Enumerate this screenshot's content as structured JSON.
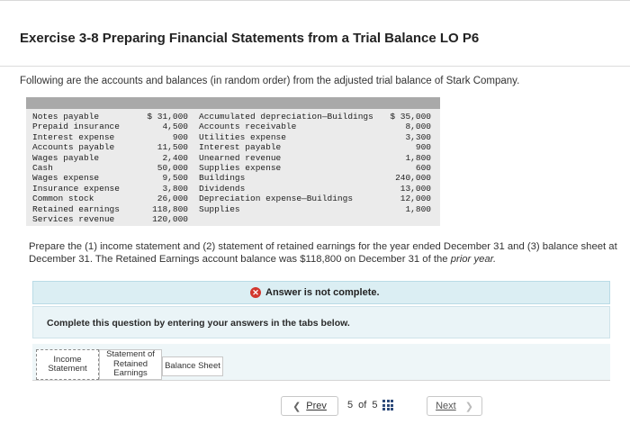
{
  "title": "Exercise 3-8 Preparing Financial Statements from a Trial Balance LO P6",
  "intro": "Following are the accounts and balances (in random order) from the adjusted trial balance of Stark Company.",
  "trial_balance": {
    "left_accounts": [
      "Notes payable",
      "Prepaid insurance",
      "Interest expense",
      "Accounts payable",
      "Wages payable",
      "Cash",
      "Wages expense",
      "Insurance expense",
      "Common stock",
      "Retained earnings",
      "Services revenue"
    ],
    "left_amounts": [
      "$ 31,000",
      "4,500",
      "900",
      "11,500",
      "2,400",
      "50,000",
      "9,500",
      "3,800",
      "26,000",
      "118,800",
      "120,000"
    ],
    "right_accounts": [
      "Accumulated depreciation—Buildings",
      "Accounts receivable",
      "Utilities expense",
      "Interest payable",
      "Unearned revenue",
      "Supplies expense",
      "Buildings",
      "Dividends",
      "Depreciation expense—Buildings",
      "Supplies"
    ],
    "right_amounts": [
      "$ 35,000",
      "8,000",
      "3,300",
      "900",
      "1,800",
      "600",
      "240,000",
      "13,000",
      "12,000",
      "1,800"
    ]
  },
  "prepare": {
    "text": "Prepare the (1) income statement and (2) statement of retained earnings for the year ended December 31 and (3) balance sheet at December 31. The Retained Earnings account balance was $118,800 on December 31 of the ",
    "emphasis": "prior year."
  },
  "status": {
    "icon": "error-x-icon",
    "text": "Answer is not complete."
  },
  "instruction": "Complete this question by entering your answers in the tabs below.",
  "tabs": [
    {
      "label": "Income Statement"
    },
    {
      "label": "Statement of Retained Earnings"
    },
    {
      "label": "Balance Sheet"
    }
  ],
  "navigation": {
    "prev_label": "Prev",
    "page_current": "5",
    "page_of": "of",
    "page_total": "5",
    "next_label": "Next"
  },
  "colors": {
    "status_bg": "#dbeef3",
    "error_red": "#d2372e",
    "grid_icon": "#2d4a7a"
  }
}
